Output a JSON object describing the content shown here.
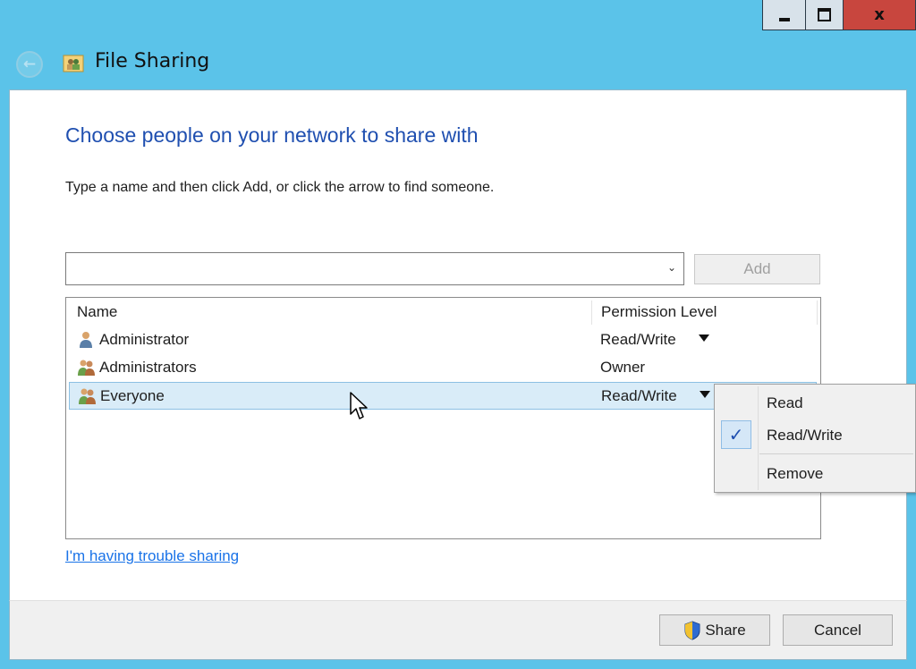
{
  "window": {
    "title": "File Sharing",
    "caption_buttons": {
      "minimize_icon": "minimize-icon",
      "maximize_icon": "maximize-icon",
      "close_label": "x"
    }
  },
  "main": {
    "heading": "Choose people on your network to share with",
    "instruction": "Type a name and then click Add, or click the arrow to find someone.",
    "name_input": {
      "value": "",
      "placeholder": ""
    },
    "add_button": "Add",
    "table": {
      "headers": {
        "name": "Name",
        "permission": "Permission Level"
      },
      "rows": [
        {
          "name": "Administrator",
          "permission": "Read/Write",
          "icon": "user-icon",
          "has_dropdown": true
        },
        {
          "name": "Administrators",
          "permission": "Owner",
          "icon": "group-icon",
          "has_dropdown": false
        },
        {
          "name": "Everyone",
          "permission": "Read/Write",
          "icon": "group-icon",
          "has_dropdown": true,
          "selected": true
        }
      ]
    },
    "trouble_link": "I'm having trouble sharing"
  },
  "context_menu": {
    "items": [
      {
        "label": "Read",
        "checked": false
      },
      {
        "label": "Read/Write",
        "checked": true
      },
      {
        "label": "Remove",
        "checked": false
      }
    ],
    "check_glyph": "✓"
  },
  "footer": {
    "share_button": "Share",
    "cancel_button": "Cancel"
  },
  "colors": {
    "frame": "#5bc3e9",
    "heading": "#1f4fb0",
    "link": "#1a73e8",
    "close_button": "#c8463e",
    "selection": "#d9ecf8"
  }
}
